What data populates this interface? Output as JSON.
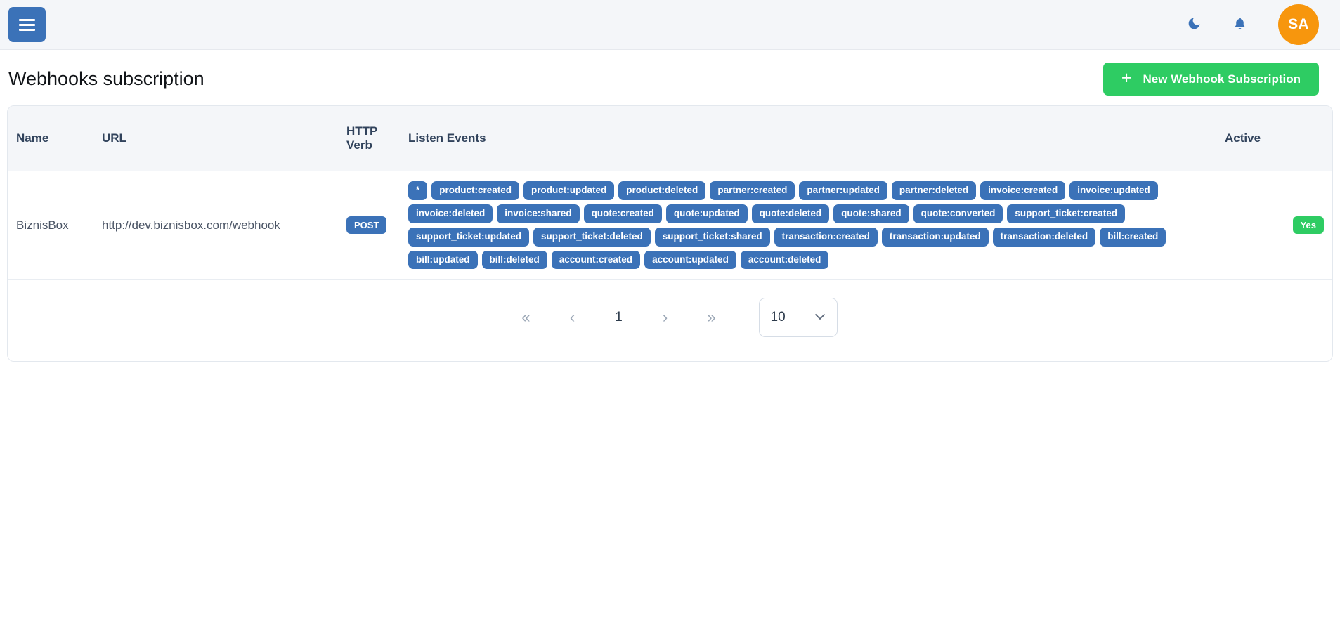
{
  "topbar": {
    "menu_button_label": "Toggle navigation",
    "dark_mode_icon": "moon-icon",
    "notifications_icon": "bell-icon",
    "avatar_initials": "SA"
  },
  "page": {
    "title": "Webhooks subscription",
    "new_button_label": "New Webhook Subscription",
    "new_button_plus": "+",
    "accent_blue": "#3b72b8",
    "accent_green": "#2ecc63",
    "avatar_orange": "#f7960d"
  },
  "table": {
    "headers": {
      "name": "Name",
      "url": "URL",
      "http_verb": "HTTP Verb",
      "listen_events": "Listen Events",
      "active": "Active"
    },
    "rows": [
      {
        "name": "BiznisBox",
        "url": "http://dev.biznisbox.com/webhook",
        "http_verb": "POST",
        "active": "Yes",
        "events": [
          "*",
          "product:created",
          "product:updated",
          "product:deleted",
          "partner:created",
          "partner:updated",
          "partner:deleted",
          "invoice:created",
          "invoice:updated",
          "invoice:deleted",
          "invoice:shared",
          "quote:created",
          "quote:updated",
          "quote:deleted",
          "quote:shared",
          "quote:converted",
          "support_ticket:created",
          "support_ticket:updated",
          "support_ticket:deleted",
          "support_ticket:shared",
          "transaction:created",
          "transaction:updated",
          "transaction:deleted",
          "bill:created",
          "bill:updated",
          "bill:deleted",
          "account:created",
          "account:updated",
          "account:deleted"
        ]
      }
    ]
  },
  "pagination": {
    "first_label": "«",
    "prev_label": "‹",
    "current_page": "1",
    "next_label": "›",
    "last_label": "»",
    "rows_per_page": "10",
    "chevron": "⌄"
  }
}
